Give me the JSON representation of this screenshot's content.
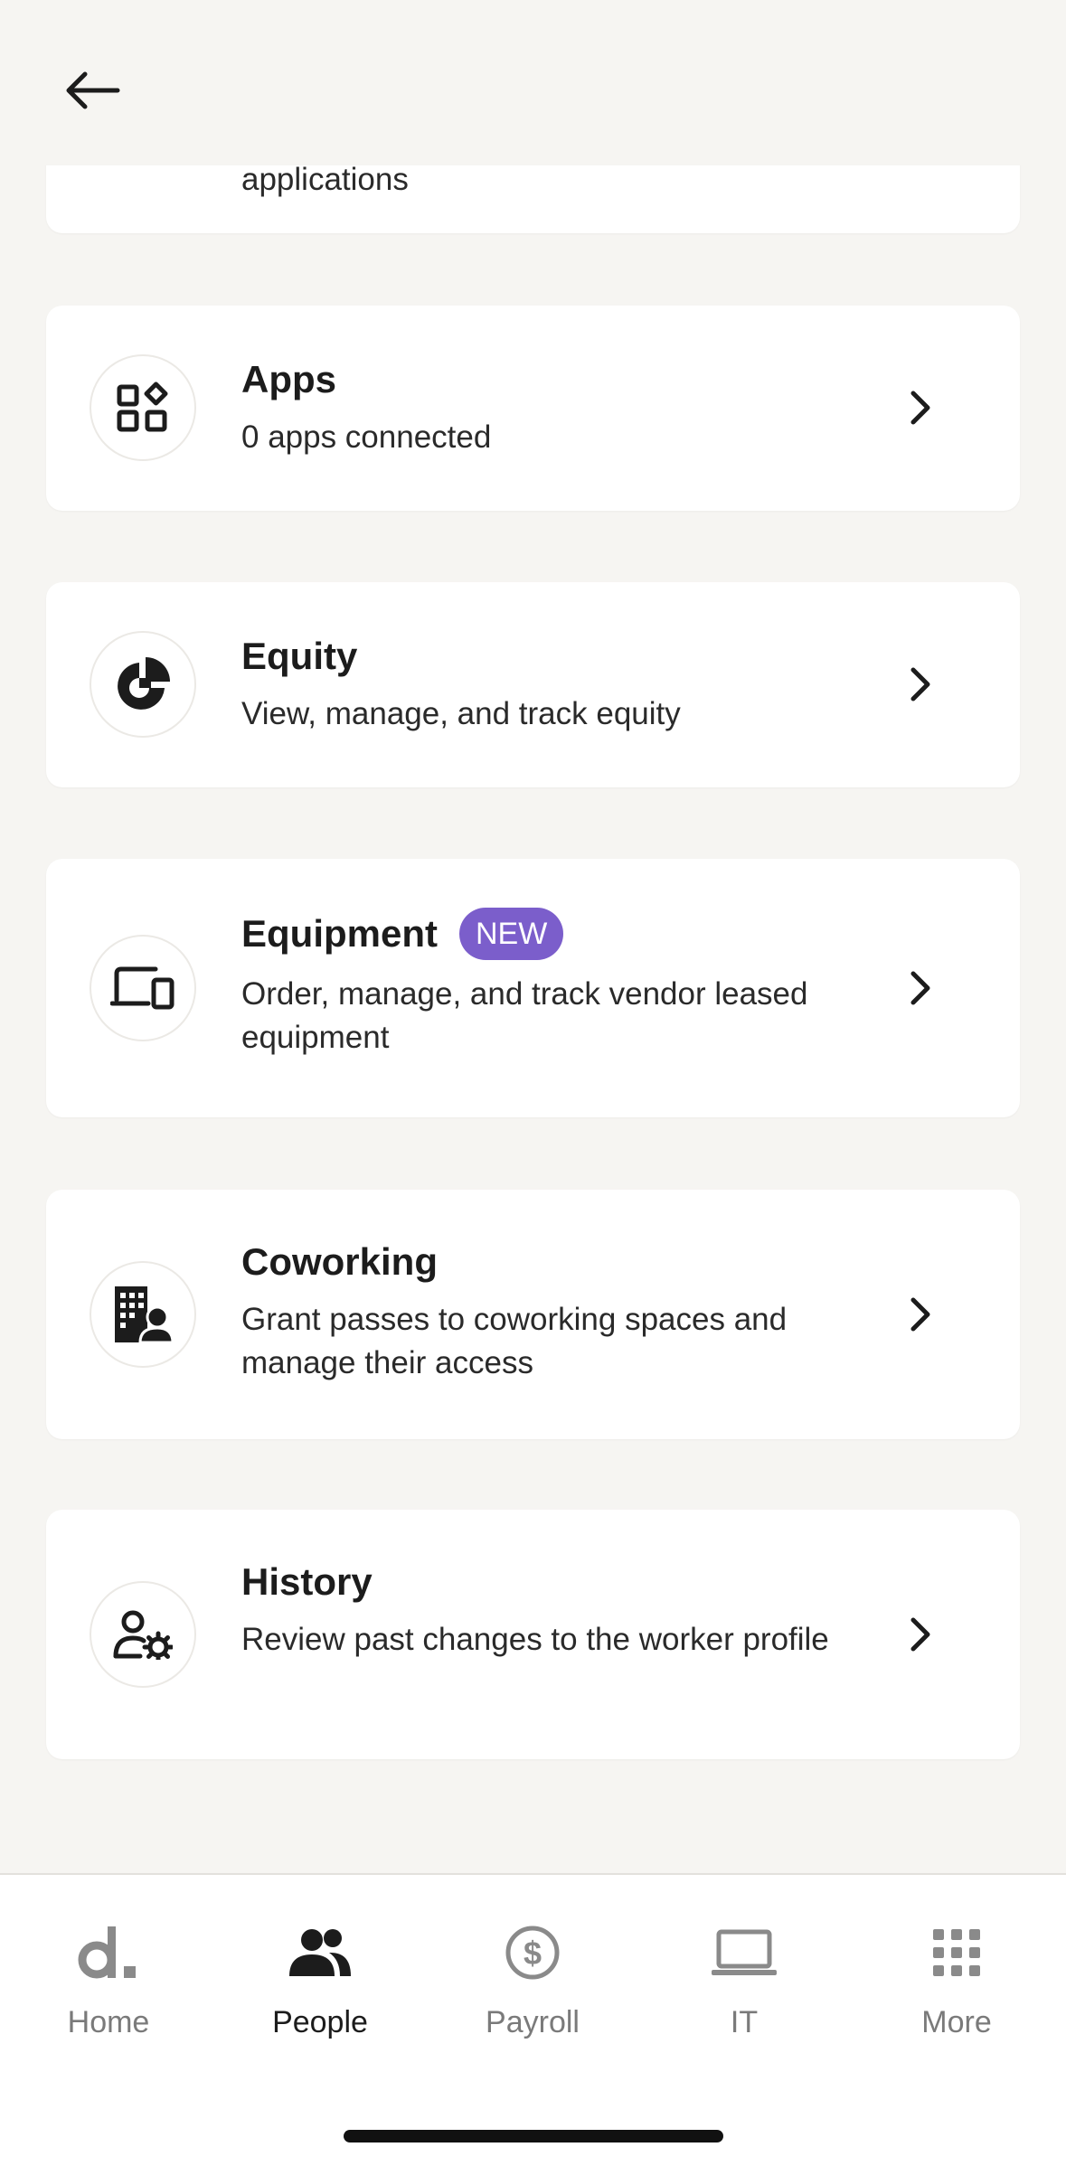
{
  "partial_card": {
    "subtitle": "applications"
  },
  "cards": [
    {
      "title": "Apps",
      "subtitle": "0 apps connected"
    },
    {
      "title": "Equity",
      "subtitle": "View, manage, and track equity"
    },
    {
      "title": "Equipment",
      "badge": "NEW",
      "subtitle": "Order, manage, and track vendor leased equipment"
    },
    {
      "title": "Coworking",
      "subtitle": "Grant passes to coworking spaces and manage their access"
    },
    {
      "title": "History",
      "subtitle": "Review past changes to the worker profile"
    }
  ],
  "tabbar": {
    "items": [
      {
        "label": "Home",
        "icon": "deel-logo-icon"
      },
      {
        "label": "People",
        "icon": "people-icon",
        "active": true
      },
      {
        "label": "Payroll",
        "icon": "dollar-circle-icon"
      },
      {
        "label": "IT",
        "icon": "laptop-icon"
      },
      {
        "label": "More",
        "icon": "grid-icon"
      }
    ]
  },
  "colors": {
    "background": "#f6f5f2",
    "card": "#ffffff",
    "badge": "#7b5ecb",
    "text": "#1c1c1c",
    "muted": "#7a7a7a"
  }
}
